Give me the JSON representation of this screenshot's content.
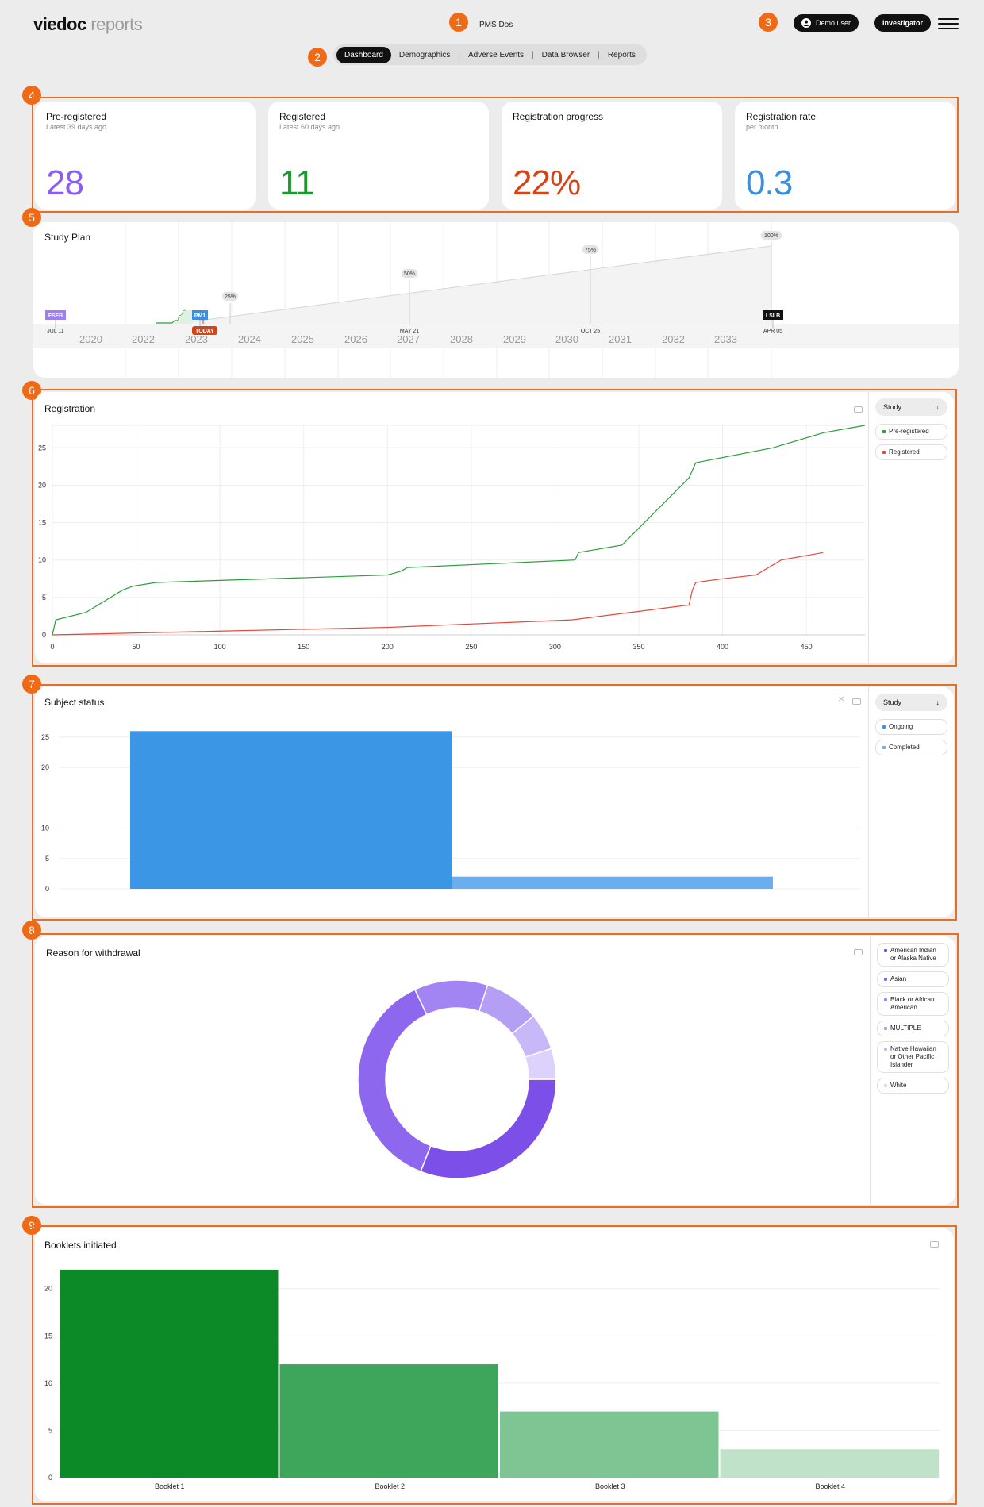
{
  "app": {
    "logo_main": "viedoc",
    "logo_sub": "reports",
    "study_name": "PMS Dos"
  },
  "markers": [
    "1",
    "2",
    "3",
    "4",
    "5",
    "6",
    "7",
    "8",
    "9"
  ],
  "nav": {
    "items": [
      {
        "label": "Dashboard"
      },
      {
        "label": "Demographics"
      },
      {
        "label": "Adverse Events"
      },
      {
        "label": "Data Browser"
      },
      {
        "label": "Reports"
      }
    ],
    "separator": "|"
  },
  "header": {
    "user_label": "Demo user",
    "role_label": "Investigator",
    "user_icon": "user-icon",
    "menu_icon": "hamburger-menu-icon"
  },
  "kpis": [
    {
      "title": "Pre-registered",
      "subtitle": "Latest 39 days ago",
      "value": "28",
      "color": "#8b5cf6"
    },
    {
      "title": "Registered",
      "subtitle": "Latest 60 days ago",
      "value": "11",
      "color": "#1a9a2a"
    },
    {
      "title": "Registration progress",
      "subtitle": "",
      "value": "22%",
      "color": "#d84315"
    },
    {
      "title": "Registration rate",
      "subtitle": "per month",
      "value": "0.3",
      "color": "#3a8fe0"
    }
  ],
  "study_plan": {
    "title": "Study Plan",
    "years": [
      "2020",
      "2022",
      "2023",
      "2024",
      "2025",
      "2026",
      "2027",
      "2028",
      "2029",
      "2030",
      "2031",
      "2032",
      "2033"
    ],
    "milestones": [
      {
        "label": "FSFB",
        "date": "JUL 11",
        "color": "#9d7ff0"
      },
      {
        "label": "PM1",
        "date": "",
        "color": "#3a8fe0"
      },
      {
        "label": "LSLB",
        "date": "APR 05",
        "color": "#111111"
      }
    ],
    "progress": [
      {
        "label": "25%",
        "date": ""
      },
      {
        "label": "50%",
        "date": "MAY 21"
      },
      {
        "label": "75%",
        "date": "OCT 25"
      },
      {
        "label": "100%",
        "date": ""
      }
    ],
    "today_label": "TODAY"
  },
  "registration": {
    "title": "Registration",
    "dropdown": "Study",
    "dropdown_icon": "arrow-down-icon",
    "camera_icon": "camera-icon",
    "legend": [
      {
        "name": "Pre-registered",
        "color": "#2a9d3a"
      },
      {
        "name": "Registered",
        "color": "#e5483b"
      }
    ]
  },
  "subject_status": {
    "title": "Subject status",
    "dropdown": "Study",
    "dropdown_icon": "arrow-down-icon",
    "camera_icon": "camera-icon",
    "reset_icon": "reset-zoom-icon",
    "legend": [
      {
        "name": "Ongoing",
        "color": "#3b97e5"
      },
      {
        "name": "Completed",
        "color": "#6aaef0"
      }
    ]
  },
  "withdrawal": {
    "title": "Reason for withdrawal",
    "camera_icon": "camera-icon",
    "legend": [
      {
        "name": "American Indian or Alaska Native",
        "color": "#7b4fe8"
      },
      {
        "name": "Asian",
        "color": "#8e67ef"
      },
      {
        "name": "Black or African American",
        "color": "#a285f2"
      },
      {
        "name": "MULTIPLE",
        "color": "#b59ff5"
      },
      {
        "name": "Native Hawaiian or Other Pacific Islander",
        "color": "#c8b8f8"
      },
      {
        "name": "White",
        "color": "#dcd2fb"
      }
    ]
  },
  "booklets": {
    "title": "Booklets initiated",
    "camera_icon": "camera-icon"
  },
  "chart_data": [
    {
      "type": "line",
      "title": "Registration",
      "xlim": [
        0,
        485
      ],
      "ylim": [
        0,
        28
      ],
      "xticks": [
        0,
        50,
        100,
        150,
        200,
        250,
        300,
        350,
        400,
        450
      ],
      "yticks": [
        0,
        5,
        10,
        15,
        20,
        25
      ],
      "series": [
        {
          "name": "Pre-registered",
          "color": "#2a9d3a",
          "x": [
            0,
            1,
            2,
            20,
            42,
            48,
            62,
            200,
            208,
            212,
            312,
            313,
            314,
            340,
            380,
            382,
            384,
            430,
            460,
            485
          ],
          "y": [
            0,
            1,
            2,
            3,
            6,
            6.5,
            7,
            8,
            8.5,
            9,
            10,
            10.5,
            11,
            12,
            21,
            22,
            23,
            25,
            27,
            28
          ]
        },
        {
          "name": "Registered",
          "color": "#e5483b",
          "x": [
            0,
            100,
            200,
            310,
            380,
            382,
            384,
            400,
            420,
            435,
            460
          ],
          "y": [
            0,
            0.5,
            1,
            2,
            4,
            6,
            7,
            7.5,
            8,
            10,
            11
          ]
        }
      ]
    },
    {
      "type": "bar",
      "title": "Subject status",
      "categories": [
        "Ongoing",
        "Completed"
      ],
      "ylim": [
        0,
        28
      ],
      "yticks": [
        0,
        5,
        10,
        20,
        25
      ],
      "series": [
        {
          "name": "Ongoing",
          "color": "#3b97e5",
          "values": [
            26
          ]
        },
        {
          "name": "Completed",
          "color": "#6aaef0",
          "values": [
            2
          ]
        }
      ]
    },
    {
      "type": "pie",
      "title": "Reason for withdrawal",
      "donut": true,
      "labels": [
        "American Indian or Alaska Native",
        "Asian",
        "Black or African American",
        "MULTIPLE",
        "Native Hawaiian or Other Pacific Islander",
        "White"
      ],
      "values": [
        31,
        37,
        12,
        9,
        6,
        5
      ],
      "colors": [
        "#7b4fe8",
        "#8e67ef",
        "#a285f2",
        "#b59ff5",
        "#c8b8f8",
        "#dcd2fb"
      ]
    },
    {
      "type": "bar",
      "title": "Booklets initiated",
      "categories": [
        "Booklet 1",
        "Booklet 2",
        "Booklet 3",
        "Booklet 4"
      ],
      "values": [
        22,
        12,
        7,
        3
      ],
      "ylim": [
        0,
        23
      ],
      "yticks": [
        0,
        5,
        10,
        15,
        20
      ],
      "colors": [
        "#0b8a27",
        "#3da65a",
        "#7dc592",
        "#bfe2c8"
      ]
    }
  ]
}
